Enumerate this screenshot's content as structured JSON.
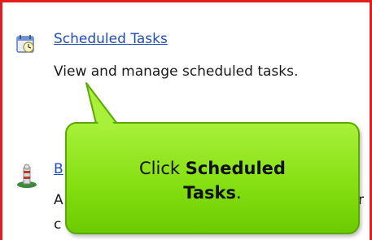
{
  "entries": [
    {
      "icon": "scheduled-tasks-icon",
      "link": "Scheduled Tasks",
      "description": "View and manage scheduled tasks."
    },
    {
      "icon": "user-computer-icon",
      "link_visible_fragment": "B",
      "description_visible_fragment_1": "A",
      "description_visible_fragment_2": "c",
      "description_right_fragment": "r"
    }
  ],
  "callout": {
    "prefix": "Click",
    "emphasis_line1": "Scheduled",
    "emphasis_line2": "Tasks",
    "suffix": "."
  },
  "colors": {
    "frame_border": "#e31c1c",
    "link": "#1f4fb5",
    "callout_fill": "#86e012",
    "callout_border": "#5aa800"
  }
}
